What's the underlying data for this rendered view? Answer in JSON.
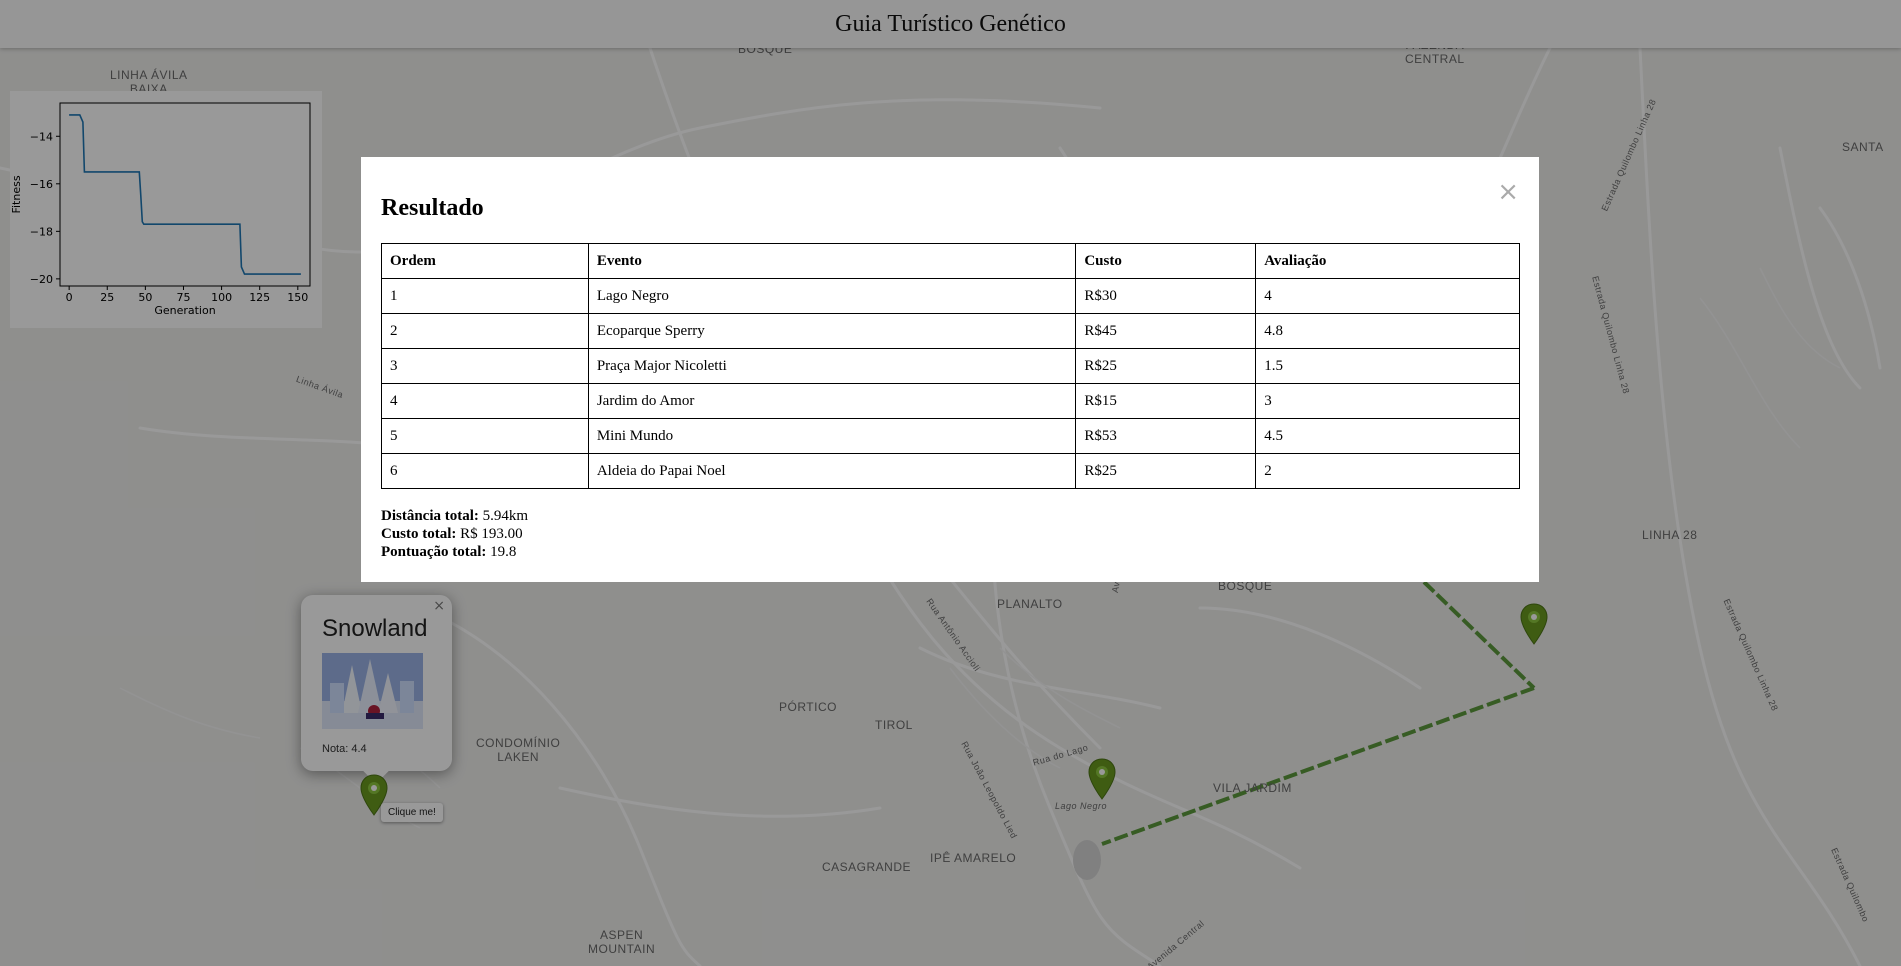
{
  "header": {
    "title": "Guia Turístico Genético"
  },
  "map": {
    "labels": [
      "LINHA ÁVILA\nBAIXA",
      "BOSQUE",
      "FAZENDA\nCENTRAL",
      "SANTA",
      "LINHA 28",
      "BOSQUE",
      "PLANALTO",
      "PÓRTICO",
      "TIROL",
      "CONDOMÍNIO\nLAKEN",
      "VILA JARDIM",
      "CASAGRANDE",
      "IPÊ AMARELO",
      "ASPEN\nMOUNTAIN",
      "Lago Negro"
    ],
    "street_labels": [
      "Linha Ávila",
      "Estrada Quilombo Linha 28",
      "Estrada Quilombo Linha 28",
      "Estrada Quilombo Linha 28",
      "Estrada Quilombo",
      "Rua Antônio Accioli",
      "Rua João Leopoldo Lied",
      "Rua do Lago",
      "Avenida",
      "Avenida Central"
    ]
  },
  "chart_data": {
    "type": "line",
    "xlabel": "Generation",
    "ylabel": "Fitness",
    "xlim": [
      -6,
      158
    ],
    "ylim": [
      -20.3,
      -12.6
    ],
    "xticks": [
      0,
      25,
      50,
      75,
      100,
      125,
      150
    ],
    "yticks": [
      -14,
      -16,
      -18,
      -20
    ],
    "x": [
      0,
      7,
      9,
      10,
      46,
      47,
      48,
      49,
      112,
      113,
      115,
      152
    ],
    "y": [
      -13.1,
      -13.1,
      -13.4,
      -15.5,
      -15.5,
      -16.5,
      -17.6,
      -17.7,
      -17.7,
      -19.5,
      -19.8,
      -19.8
    ],
    "series_color": "#1f77b4"
  },
  "modal": {
    "title": "Resultado",
    "close_label": "×",
    "columns": [
      "Ordem",
      "Evento",
      "Custo",
      "Avaliação"
    ],
    "rows": [
      [
        "1",
        "Lago Negro",
        "R$30",
        "4"
      ],
      [
        "2",
        "Ecoparque Sperry",
        "R$45",
        "4.8"
      ],
      [
        "3",
        "Praça Major Nicoletti",
        "R$25",
        "1.5"
      ],
      [
        "4",
        "Jardim do Amor",
        "R$15",
        "3"
      ],
      [
        "5",
        "Mini Mundo",
        "R$53",
        "4.5"
      ],
      [
        "6",
        "Aldeia do Papai Noel",
        "R$25",
        "2"
      ]
    ],
    "totals": {
      "distance_label": "Distância total:",
      "distance_value": "5.94km",
      "cost_label": "Custo total:",
      "cost_value": "R$ 193.00",
      "score_label": "Pontuação total:",
      "score_value": "19.8"
    }
  },
  "popup": {
    "title": "Snowland",
    "note": "Nota: 4.4",
    "close_label": "×"
  },
  "tooltip": {
    "text": "Clique me!"
  },
  "colors": {
    "pin": "#6a9a1f",
    "route": "#5c9a3c",
    "overlay": "rgba(0,0,0,0.4)"
  }
}
